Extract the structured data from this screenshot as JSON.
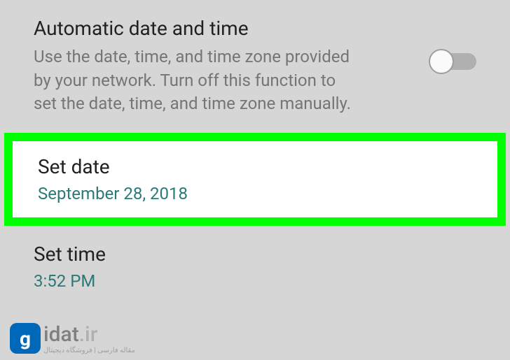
{
  "settings": {
    "auto_datetime": {
      "title": "Automatic date and time",
      "description": "Use the date, time, and time zone provided by your network. Turn off this function to set the date, time, and time zone manually.",
      "enabled": false
    },
    "set_date": {
      "title": "Set date",
      "value": "September 28, 2018"
    },
    "set_time": {
      "title": "Set time",
      "value": "3:52 PM"
    }
  },
  "watermark": {
    "icon_letter": "g",
    "brand": "idat",
    "domain": ".ir",
    "tagline": "مقاله فارسی | فروشگاه دیجیتال"
  }
}
